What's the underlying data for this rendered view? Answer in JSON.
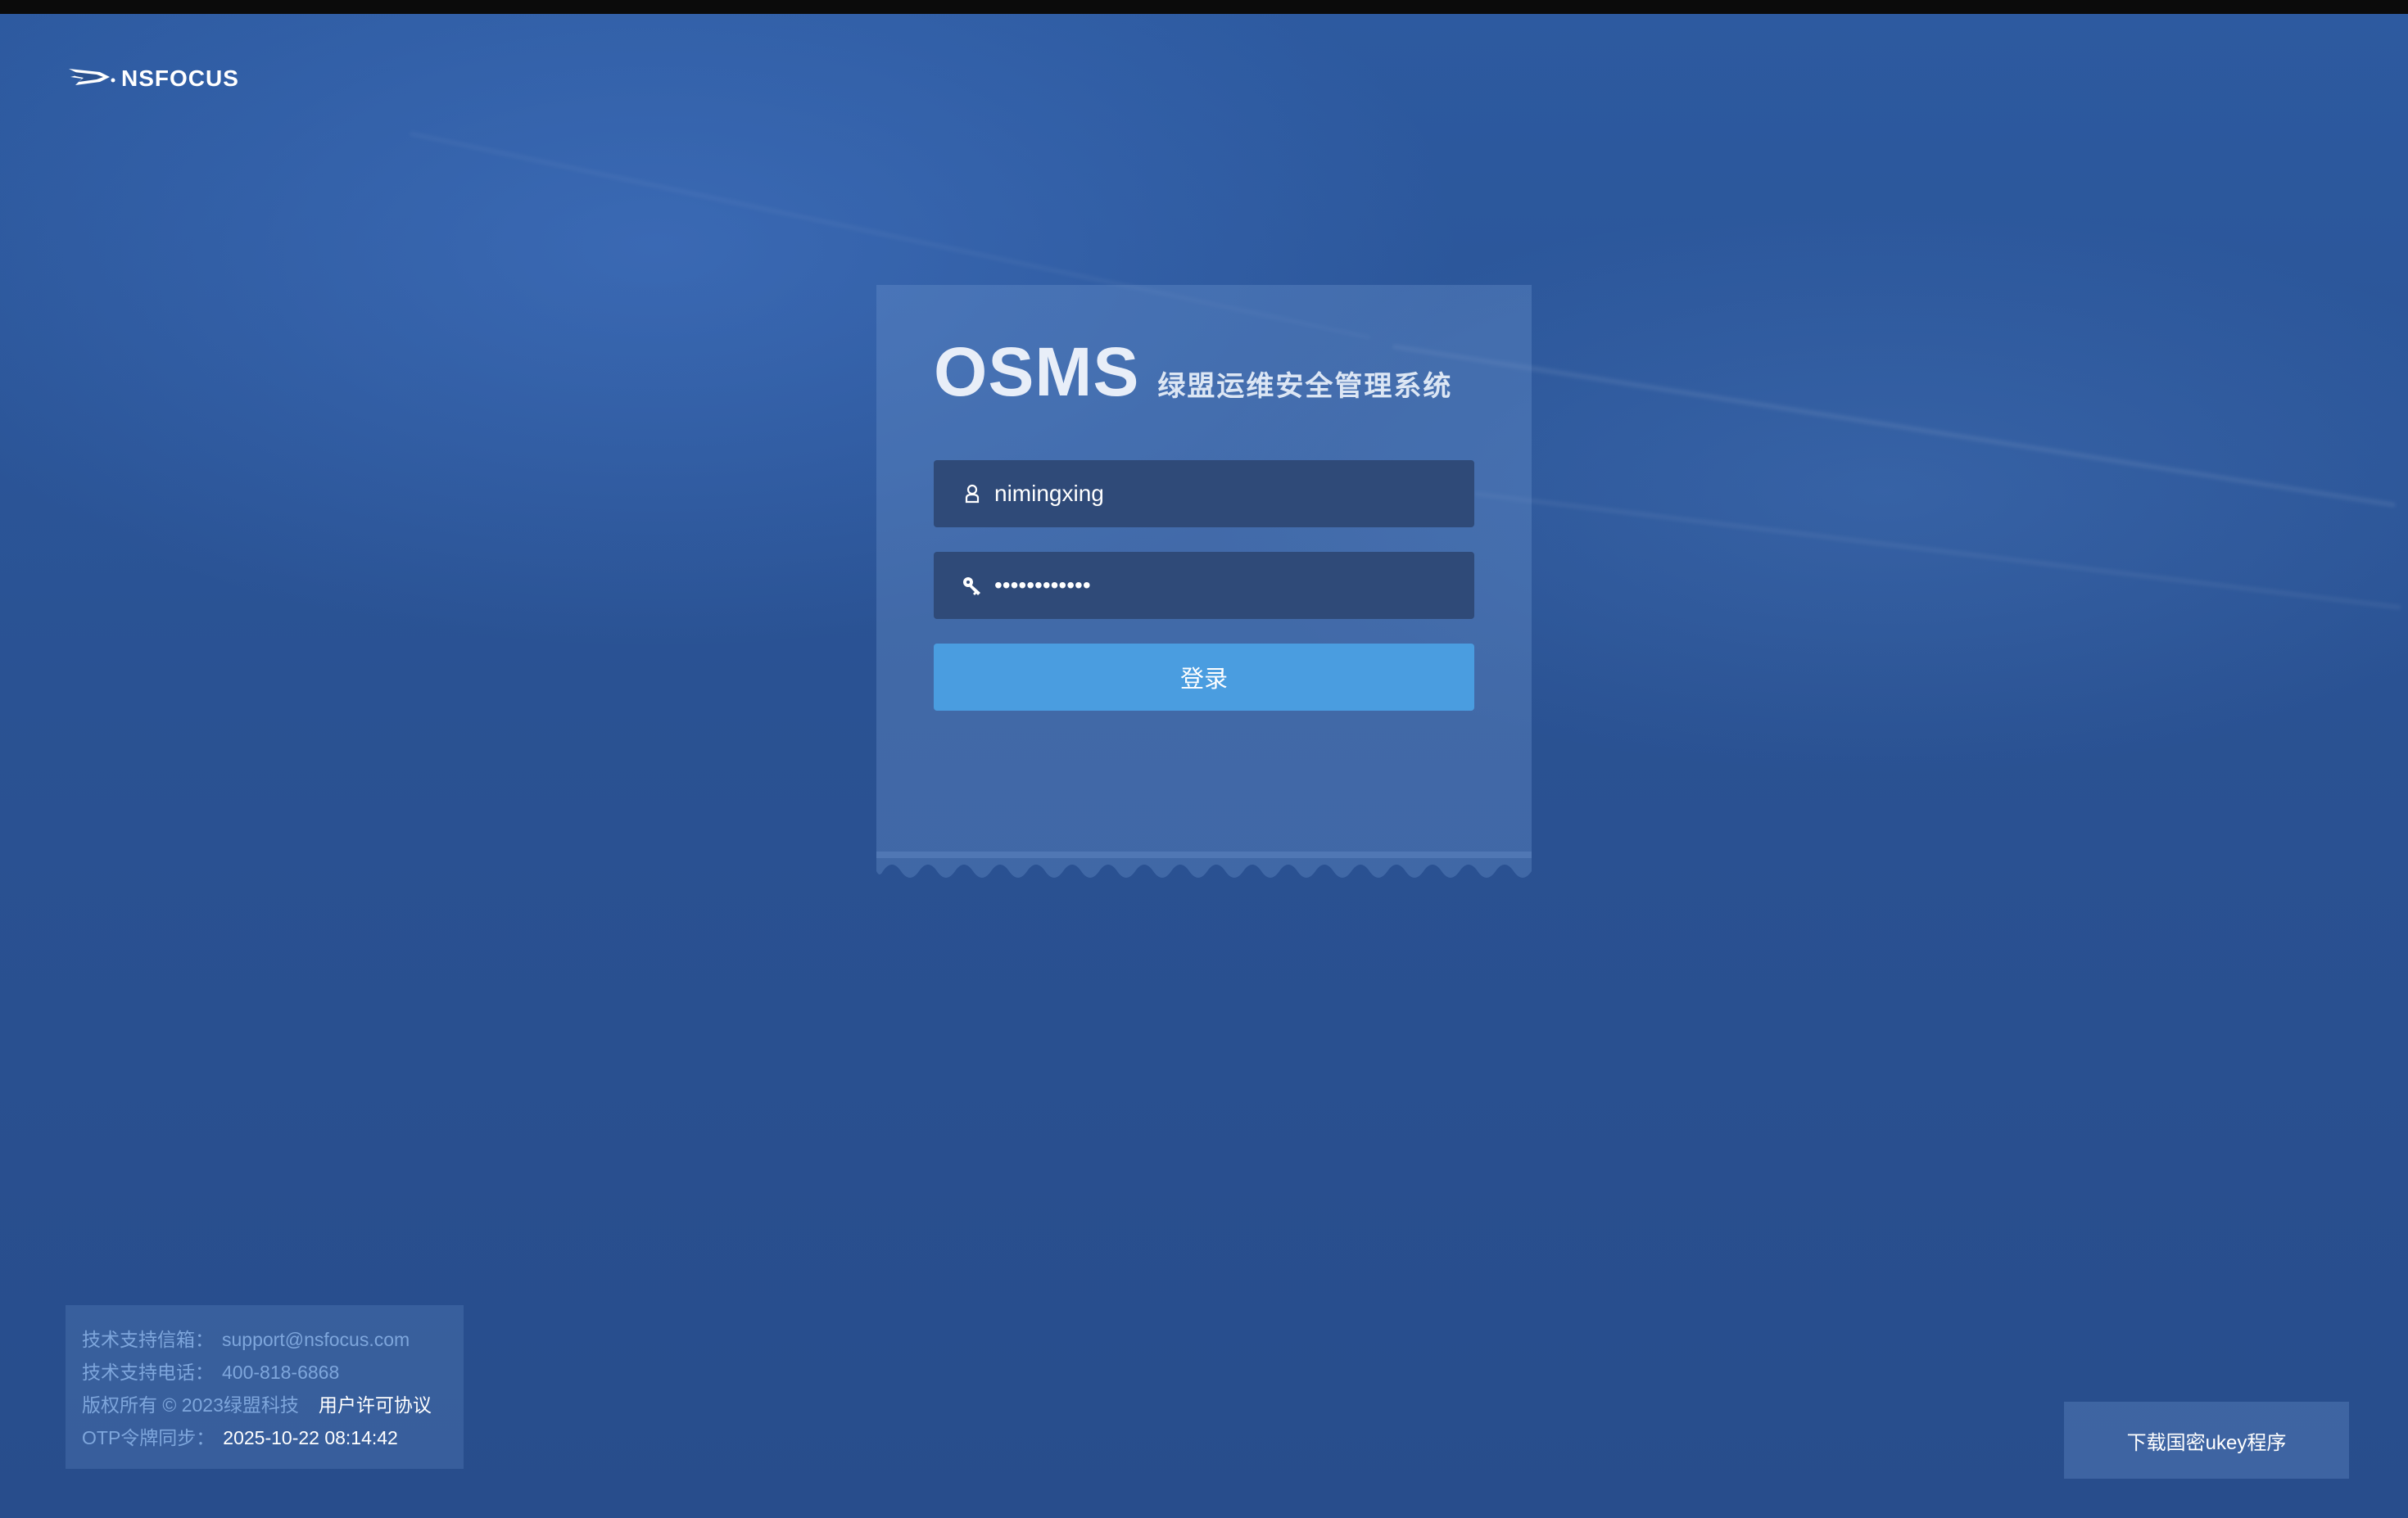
{
  "brand": {
    "logo_text": "NSFOCUS"
  },
  "login": {
    "title_main": "OSMS",
    "title_sub": "绿盟运维安全管理系统",
    "username_value": "nimingxing",
    "password_value": "••••••••••••",
    "login_button_label": "登录"
  },
  "footer": {
    "email_label": "技术支持信箱：",
    "email_value": "support@nsfocus.com",
    "phone_label": "技术支持电话：",
    "phone_value": "400-818-6868",
    "copyright_text": "版权所有 © 2023绿盟科技",
    "license_link": "用户许可协议",
    "otp_label": "OTP令牌同步：",
    "otp_value": "2025-10-22 08:14:42"
  },
  "ukey": {
    "download_label": "下载国密ukey程序"
  },
  "colors": {
    "background": "#2a5190",
    "login_button": "#4a9de0",
    "input_bg": "#2f4a78",
    "info_label": "#7ea6dc"
  },
  "icons": {
    "user": "user-icon",
    "password": "key-icon",
    "logo": "nsfocus-logo-icon"
  }
}
